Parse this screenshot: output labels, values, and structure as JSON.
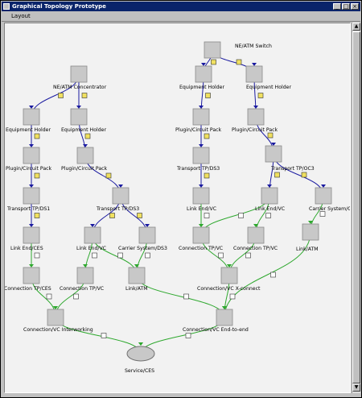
{
  "window": {
    "title": "Graphical Topology Prototype"
  },
  "menu": {
    "items": [
      "Layout"
    ]
  },
  "graph": {
    "colors": {
      "blue_edge": "#1a1aa0",
      "green_edge": "#2ea82e",
      "node_fill": "#c8c8c8",
      "badge_fill": "#f0e060"
    },
    "nodes": [
      {
        "id": "n1",
        "label": "NE/ATM Switch"
      },
      {
        "id": "n2",
        "label": "NE/ATM Concentrator"
      },
      {
        "id": "n3",
        "label": "Equipment Holder"
      },
      {
        "id": "n4",
        "label": "Equipment Holder"
      },
      {
        "id": "n5",
        "label": "Equipment Holder"
      },
      {
        "id": "n6",
        "label": "Equipment Holder"
      },
      {
        "id": "n7",
        "label": "Plugin/Circuit Pack"
      },
      {
        "id": "n8",
        "label": "Plugin/Circuit Pack"
      },
      {
        "id": "n9",
        "label": "Plugin/Circuit Pack"
      },
      {
        "id": "n10",
        "label": "Plugin/Circuit Pack"
      },
      {
        "id": "n11",
        "label": "Transport TP/DS1"
      },
      {
        "id": "n12",
        "label": "Transport TP/DS3"
      },
      {
        "id": "n13",
        "label": "Transport TP/DS3"
      },
      {
        "id": "n14",
        "label": "Transport TP/OC3"
      },
      {
        "id": "n15",
        "label": "Link End/CES"
      },
      {
        "id": "n16",
        "label": "Link End/VC"
      },
      {
        "id": "n17",
        "label": "Carrier System/DS3"
      },
      {
        "id": "n18",
        "label": "Link End/VC"
      },
      {
        "id": "n19",
        "label": "Link End/VC"
      },
      {
        "id": "n20",
        "label": "Carrier System/OC3"
      },
      {
        "id": "n21",
        "label": "Connection TP/CES"
      },
      {
        "id": "n22",
        "label": "Connection TP/VC"
      },
      {
        "id": "n23",
        "label": "Link/ATM"
      },
      {
        "id": "n24",
        "label": "Connection TP/VC"
      },
      {
        "id": "n25",
        "label": "Connection TP/VC"
      },
      {
        "id": "n26",
        "label": "Link/ATM"
      },
      {
        "id": "n27",
        "label": "Connection/VC X-connect"
      },
      {
        "id": "n28",
        "label": "Connection/VC Interworking"
      },
      {
        "id": "n29",
        "label": "Connection/VC End-to-end"
      },
      {
        "id": "n30",
        "label": "Service/CES"
      }
    ]
  }
}
